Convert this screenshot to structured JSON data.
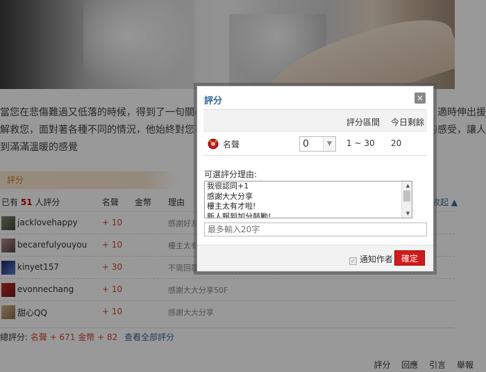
{
  "article": {
    "line1": "當您在悲傷難過又低落的時候，得到了一句關心，就像是在黑暗中看到一道光芒，讓人感到無比溫暖，適時伸出援手來",
    "line2": "解救您，面對著各種不同的情況，他始終對您不離不棄，讓您在迷茫中找到方向，這是一種多麼幸福的感受，讓人感受",
    "line3": "到滿滿溫暖的感覺"
  },
  "rate_section": {
    "title": "評分"
  },
  "rate_header": {
    "count_prefix": "已有",
    "count": "51",
    "count_suffix": "人評分",
    "col_fame": "名聲",
    "col_coin": "金幣",
    "col_reason": "理由",
    "sort_link": "收起"
  },
  "rate_rows": [
    {
      "user": "jacklovehappy",
      "fame": "+ 10",
      "reason": "感謝好友分享"
    },
    {
      "user": "becarefulyouyou",
      "fame": "+ 10",
      "reason": "樓主太有才啦"
    },
    {
      "user": "kinyet157",
      "fame": "+ 30",
      "reason": "不需回覆"
    },
    {
      "user": "evonnechang",
      "fame": "+ 10",
      "reason": "感謝大大分享50F"
    },
    {
      "user": "甜心QQ",
      "fame": "+ 10",
      "reason": "感謝大大分享"
    }
  ],
  "rate_summary": {
    "label": "總評分:",
    "fame": "名聲 + 671",
    "coin": "金幣 + 82",
    "view_all": "查看全部評分"
  },
  "footer_links": [
    "評分",
    "回應",
    "引言",
    "舉報"
  ],
  "modal": {
    "title": "評分",
    "close_glyph": "×",
    "col_range": "評分區間",
    "col_today": "今日剩餘",
    "category": "名聲",
    "selected_value": "0",
    "range": "1 ~ 30",
    "remaining": "20",
    "reason_label": "可選評分理由:",
    "reasons": [
      "我很認同+1",
      "感謝大大分享",
      "樓主太有才啦!",
      "新人報到加分鼓勵!"
    ],
    "reason_placeholder": "最多輸入20字",
    "notify_label": "通知作者",
    "confirm_label": "確定"
  },
  "colors": {
    "accent_blue": "#336699",
    "fame_red": "#d2452a",
    "confirm_red": "#d11b1b"
  }
}
